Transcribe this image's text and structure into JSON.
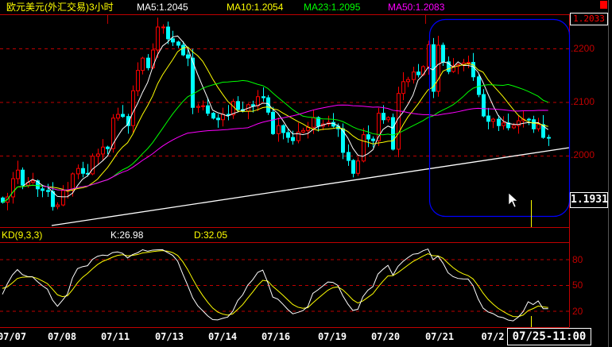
{
  "header": {
    "title": "欧元美元(外汇交易)3小时",
    "ma5": "MA5:1.2045",
    "ma10": "MA10:1.2054",
    "ma23": "MA23:1.2095",
    "ma50": "MA50:1.2083"
  },
  "price_axis": {
    "top_box": "1.2033",
    "bottom_box": "1.1931",
    "ticks": [
      ".2200",
      ".2100",
      ".2000"
    ]
  },
  "kd": {
    "label": "KD(9,3,3)",
    "k": "K:26.98",
    "d": "D:32.05",
    "ticks": [
      "80",
      "50",
      "20"
    ]
  },
  "date_axis": {
    "labels": [
      "07/07",
      "07/08",
      "07/11",
      "07/13",
      "07/14",
      "07/16",
      "07/19",
      "07/20",
      "07/21",
      "07/2"
    ],
    "cursor_date": "07/25-11:00"
  },
  "colors": {
    "up": "#ff0000",
    "down": "#00ffff",
    "ma5": "#ffffff",
    "ma10": "#ffff00",
    "ma23": "#00ff00",
    "ma50": "#ff00ff",
    "grid": "#c00000",
    "selection": "#0000ff"
  },
  "chart_data": {
    "type": "candlestick",
    "title": "欧元美元(外汇交易)3小时",
    "ylim": [
      1.187,
      1.226
    ],
    "closes": [
      1.1913,
      1.1923,
      1.1957,
      1.1973,
      1.1945,
      1.195,
      1.1953,
      1.1938,
      1.1935,
      1.1933,
      1.1905,
      1.1908,
      1.1935,
      1.1936,
      1.1966,
      1.1976,
      1.1967,
      1.1966,
      1.1999,
      1.2003,
      1.2016,
      1.2013,
      1.207,
      1.2077,
      1.2073,
      1.2056,
      1.2121,
      1.2159,
      1.2182,
      1.2164,
      1.2197,
      1.224,
      1.224,
      1.2218,
      1.2212,
      1.2206,
      1.2188,
      1.2182,
      1.209,
      1.2092,
      1.2093,
      1.2079,
      1.207,
      1.2067,
      1.2077,
      1.2076,
      1.2101,
      1.2086,
      1.2083,
      1.2095,
      1.2093,
      1.211,
      1.2108,
      1.2081,
      1.2041,
      1.2056,
      1.2043,
      1.2034,
      1.2028,
      1.2044,
      1.2047,
      1.2053,
      1.2071,
      1.2055,
      1.2059,
      1.2062,
      1.2055,
      1.205,
      1.2006,
      1.1991,
      1.1967,
      1.199,
      1.2039,
      1.2031,
      1.2028,
      1.2079,
      1.2067,
      1.2071,
      1.2012,
      1.2116,
      1.2138,
      1.2142,
      1.2156,
      1.2151,
      1.2166,
      1.2207,
      1.212,
      1.2206,
      1.2175,
      1.2157,
      1.2167,
      1.217,
      1.2173,
      1.2174,
      1.2147,
      1.2114,
      1.2074,
      1.2064,
      1.2068,
      1.2056,
      1.2061,
      1.2052,
      1.2056,
      1.2065,
      1.2068,
      1.2067,
      1.205,
      1.2058,
      1.2034,
      1.2033
    ],
    "ma_periods": [
      5,
      10,
      23,
      50
    ],
    "kd_params": [
      9,
      3,
      3
    ],
    "trendline": {
      "from_price": 1.187,
      "to_price": 1.2015
    },
    "grid": true
  }
}
